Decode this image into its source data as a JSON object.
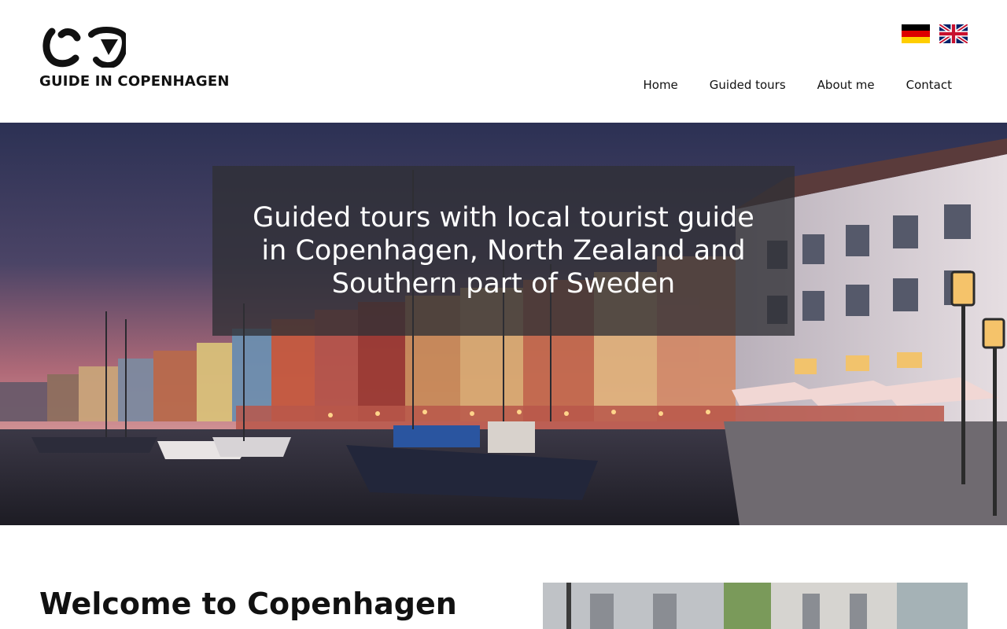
{
  "brand": {
    "logo_text": "GUIDE IN COPENHAGEN"
  },
  "languages": [
    {
      "name": "Deutsch",
      "flag": "german-flag-icon"
    },
    {
      "name": "English",
      "flag": "uk-flag-icon"
    }
  ],
  "nav": {
    "items": [
      {
        "label": "Home"
      },
      {
        "label": "Guided tours"
      },
      {
        "label": "About me"
      },
      {
        "label": "Contact"
      }
    ]
  },
  "hero": {
    "title": "Guided tours with local tourist guide in Copenhagen, North Zealand and Southern part of Sweden"
  },
  "welcome": {
    "title": "Welcome to Copenhagen"
  },
  "colors": {
    "text": "#111111",
    "overlay": "#303034",
    "background": "#ffffff"
  }
}
